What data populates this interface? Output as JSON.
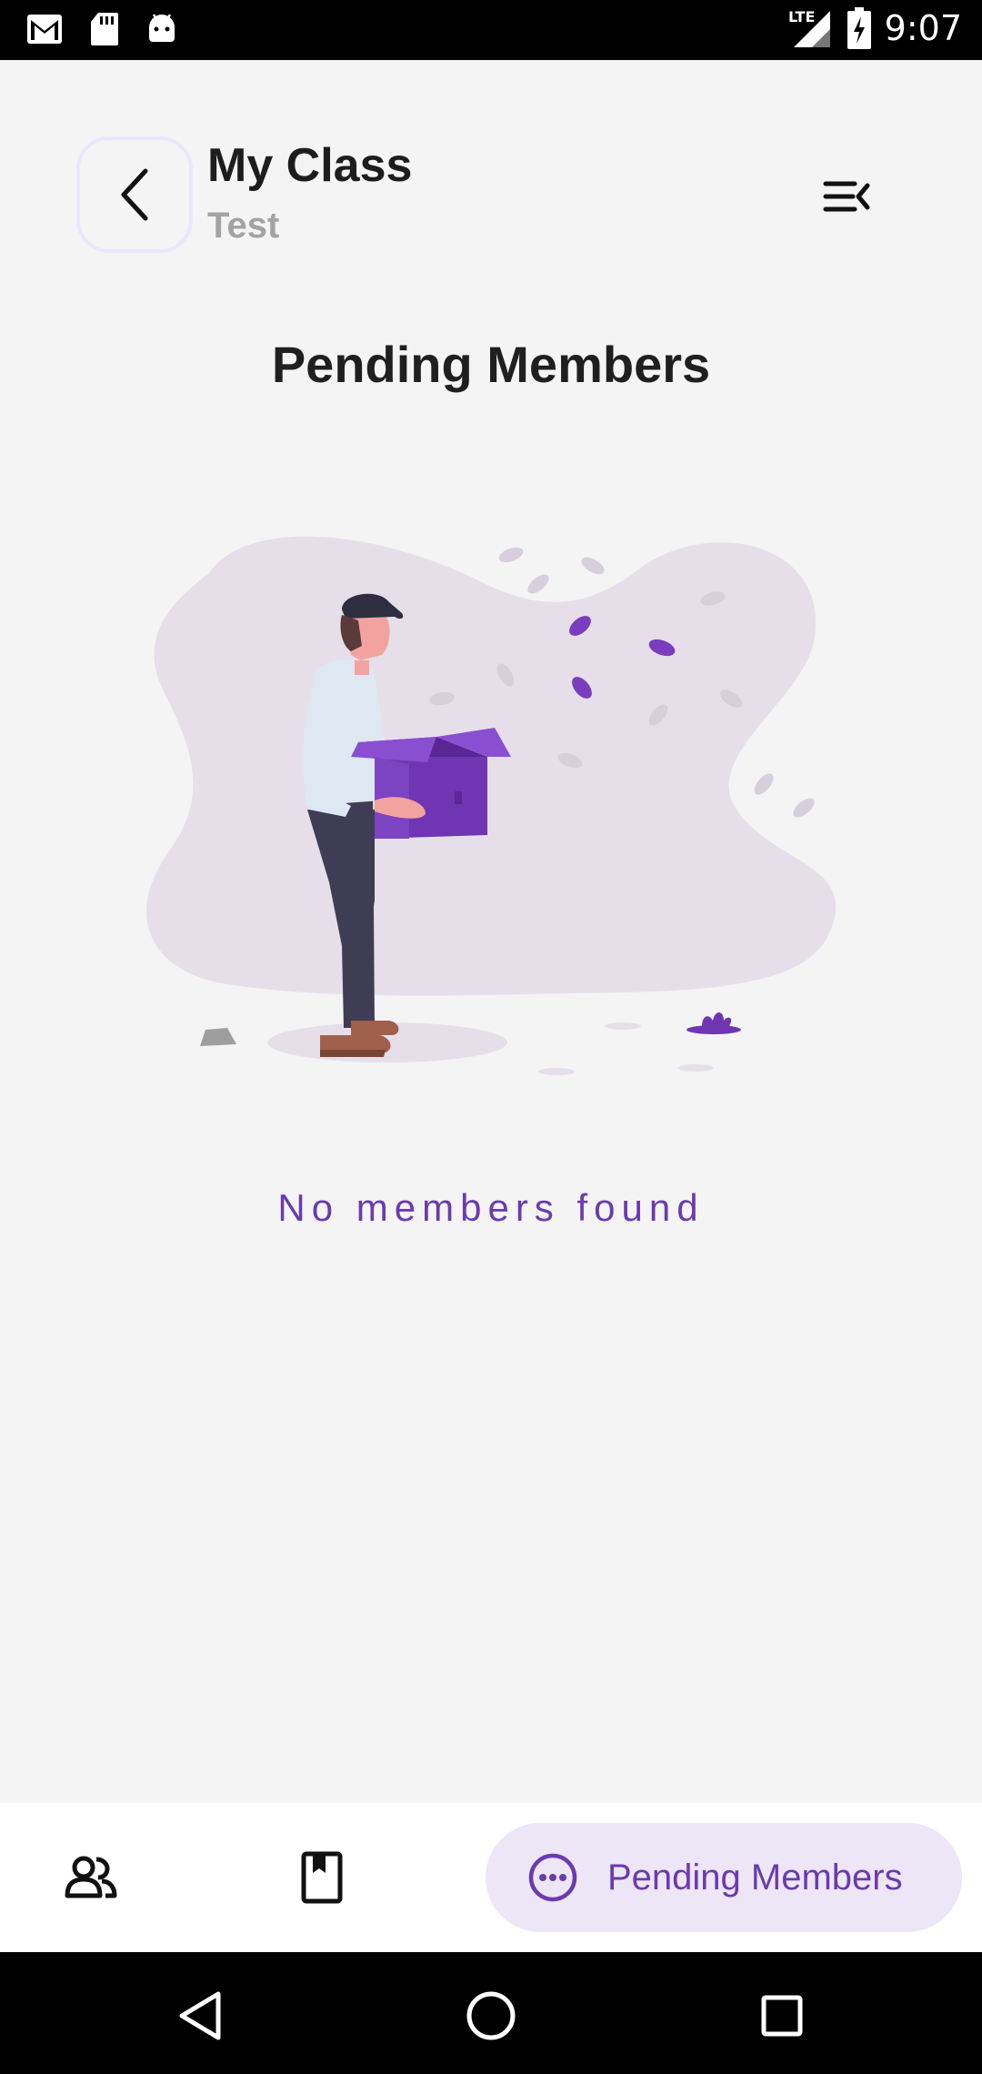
{
  "status_bar": {
    "time": "9:07",
    "network": "LTE",
    "left_icons": [
      "gmail-icon",
      "sd-card-icon",
      "android-icon"
    ],
    "right_icons": [
      "signal-icon",
      "battery-charging-icon"
    ]
  },
  "header": {
    "title": "My Class",
    "subtitle": "Test",
    "back_icon": "chevron-left-icon",
    "menu_icon": "menu-collapse-icon"
  },
  "page": {
    "heading": "Pending Members",
    "empty_message": "No members found"
  },
  "bottom_nav": {
    "items": [
      {
        "icon": "people-icon",
        "label": ""
      },
      {
        "icon": "book-icon",
        "label": ""
      },
      {
        "icon": "more-circle-icon",
        "label": "Pending Members",
        "active": true
      }
    ]
  },
  "colors": {
    "accent": "#6a3bae",
    "accent_light": "#ede6f6",
    "background": "#f4f4f4",
    "text_dark": "#1d1d1d",
    "text_muted": "#a3a3a3"
  }
}
